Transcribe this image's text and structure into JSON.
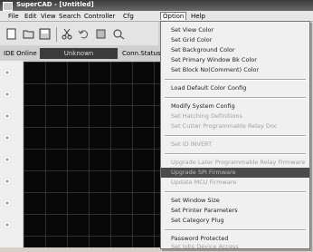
{
  "window": {
    "title": "SuperCAD - [Untitled]"
  },
  "menu": [
    "File",
    "Edit",
    "View",
    "Search",
    "Controller",
    "Cfg",
    "Option",
    "Help"
  ],
  "statusbar": {
    "left": "IDE Online",
    "mid": "Unknown",
    "right": "Conn.Status"
  },
  "option_menu": {
    "items": [
      {
        "label": "Set View Color",
        "disabled": false
      },
      {
        "label": "Set Grid Color",
        "disabled": false
      },
      {
        "label": "Set Background Color",
        "disabled": false
      },
      {
        "label": "Set Primary Window Bk Color",
        "disabled": false
      },
      {
        "label": "Set Block No(Comment) Color",
        "disabled": false
      },
      {
        "label": "Load Default Color Config",
        "disabled": false
      },
      {
        "label": "Modify System Config",
        "disabled": false
      },
      {
        "label": "Set Hatching Definitions",
        "disabled": true
      },
      {
        "label": "Set Cutter Programmable Relay Doc",
        "disabled": true
      },
      {
        "label": "Set ID INVERT",
        "disabled": true
      },
      {
        "label": "Upgrade Later Programmable Relay Firmware",
        "disabled": true
      },
      {
        "label": "Upgrade SPI Firmware",
        "disabled": true,
        "highlighted": true
      },
      {
        "label": "Update MCU Firmware",
        "disabled": true
      },
      {
        "label": "Set Window Size",
        "disabled": false
      },
      {
        "label": "Set Printer Parameters",
        "disabled": false
      },
      {
        "label": "Set Category Plug",
        "disabled": false
      },
      {
        "label": "Password Protected",
        "disabled": false
      },
      {
        "label": "Set Jobs Device Access",
        "disabled": true
      }
    ]
  }
}
